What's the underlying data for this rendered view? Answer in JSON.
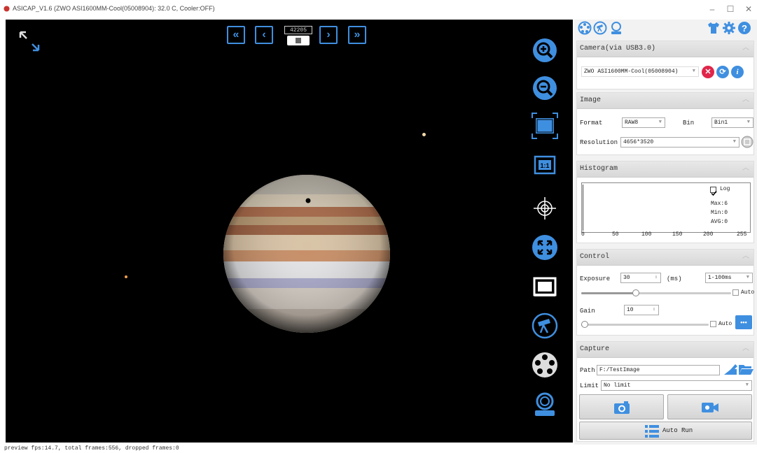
{
  "window": {
    "title": "ASICAP_V1.6 (ZWO ASI1600MM-Cool(05008904): 32.0 C, Cooler:OFF)",
    "minimize": "–",
    "maximize": "☐",
    "close": "✕"
  },
  "preview": {
    "frame_counter": "42205",
    "nav": {
      "first": "«",
      "prev": "‹",
      "next": "›",
      "last": "»"
    }
  },
  "status": {
    "text": "preview fps:14.7, total frames:556, dropped frames:0"
  },
  "camera": {
    "header": "Camera(via USB3.0)",
    "selected": "ZWO ASI1600MM-Cool(05008904)"
  },
  "image": {
    "header": "Image",
    "format_label": "Format",
    "format_value": "RAW8",
    "bin_label": "Bin",
    "bin_value": "Bin1",
    "resolution_label": "Resolution",
    "resolution_value": "4656*3520"
  },
  "histogram": {
    "header": "Histogram",
    "log_label": "Log",
    "log_checked": true,
    "max": "Max:6",
    "min": "Min:0",
    "avg": "AVG:0",
    "ticks": [
      "0",
      "50",
      "100",
      "150",
      "200",
      "255"
    ]
  },
  "control": {
    "header": "Control",
    "exposure_label": "Exposure",
    "exposure_value": "30",
    "exposure_unit": "(ms)",
    "exposure_range": "1-100ms",
    "exposure_auto_label": "Auto",
    "exposure_slider_fraction": 0.36,
    "gain_label": "Gain",
    "gain_value": "10",
    "gain_auto_label": "Auto",
    "gain_slider_fraction": 0.02,
    "more_button": "•••"
  },
  "capture": {
    "header": "Capture",
    "path_label": "Path",
    "path_value": "F:/TestImage",
    "limit_label": "Limit",
    "limit_value": "No limit",
    "auto_run_label": "Auto Run"
  },
  "colors": {
    "accent": "#3f8fe0",
    "preview_bg": "#000000",
    "close_red": "#e0264a"
  }
}
